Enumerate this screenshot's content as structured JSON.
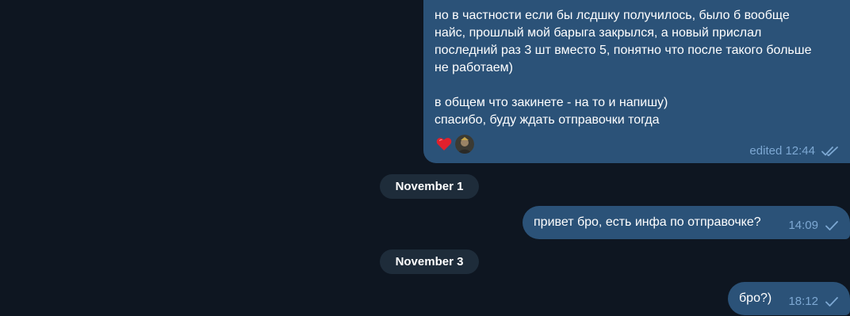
{
  "messages": [
    {
      "paragraph1": "но в частности если бы лсдшку получилось, было б вообще\nнайс, прошлый мой барыга закрылся, а новый прислал\nпоследний раз 3 шт вместо 5, понятно что после такого больше\nне работаем)",
      "paragraph2": "в общем что закинете - на то и напишу)\nспасибо, буду ждать отправочки тогда",
      "time": "edited 12:44",
      "status_icon": "double-check-icon",
      "reactions": [
        "heart",
        "avatar"
      ]
    },
    {
      "text": "привет бро, есть инфа по отправочке?",
      "time": "14:09",
      "status_icon": "check-icon"
    },
    {
      "text": "бро?)",
      "time": "18:12",
      "status_icon": "check-icon"
    }
  ],
  "dates": [
    "November 1",
    "November 3"
  ],
  "colors": {
    "background": "#0e1621",
    "bubble": "#2b5278",
    "meta": "#7da8d3",
    "date_pill": "#1e2c3a",
    "heart": "#e0202c"
  }
}
